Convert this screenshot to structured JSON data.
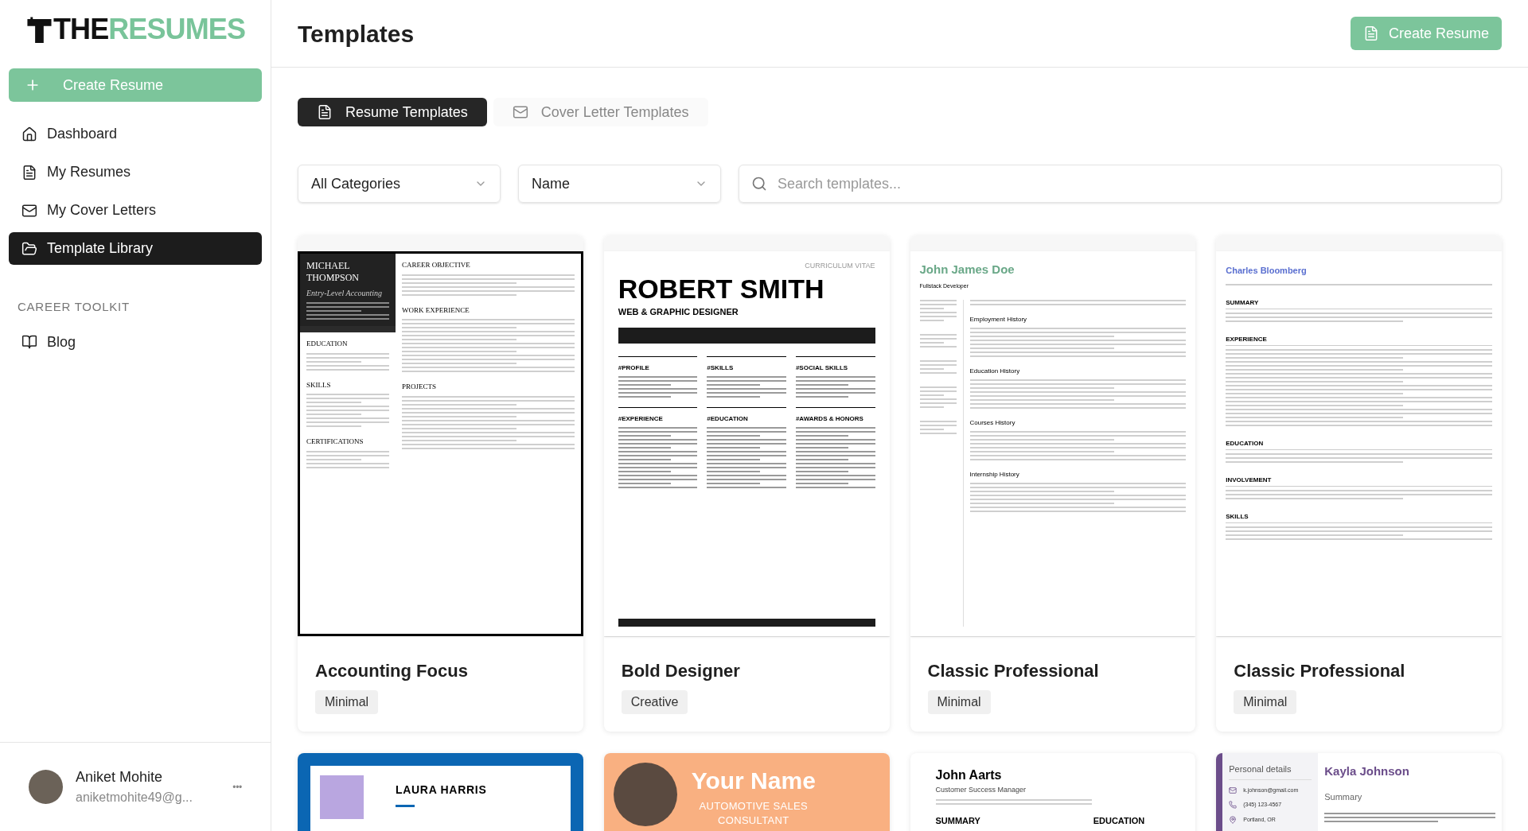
{
  "sidebar": {
    "logo": {
      "prefix": "THE",
      "suffix": "RESUMES"
    },
    "create_button": "Create Resume",
    "items": [
      {
        "label": "Dashboard",
        "selected": false
      },
      {
        "label": "My Resumes",
        "selected": false
      },
      {
        "label": "My Cover Letters",
        "selected": false
      },
      {
        "label": "Template Library",
        "selected": true
      }
    ],
    "section_title": "CAREER TOOLKIT",
    "section_items": [
      {
        "label": "Blog",
        "selected": false
      }
    ],
    "user": {
      "name": "Aniket Mohite",
      "email": "aniketmohite49@g...",
      "menu": "•••"
    }
  },
  "header": {
    "title": "Templates",
    "button": "Create Resume"
  },
  "tabs": [
    {
      "label": "Resume Templates",
      "selected": true
    },
    {
      "label": "Cover Letter Templates",
      "selected": false
    }
  ],
  "filters": {
    "category": "All Categories",
    "sort": "Name",
    "search": {
      "placeholder": "Search templates..."
    }
  },
  "templates": [
    {
      "name": "Accounting Focus",
      "tag": "Minimal",
      "preview": {
        "kind": "dark-sidebar",
        "heading": "MICHAEL THOMPSON",
        "subtitle": "Entry-Level Accounting",
        "side_sections": [
          "EDUCATION",
          "SKILLS",
          "CERTIFICATIONS"
        ],
        "sections": [
          "CAREER OBJECTIVE",
          "WORK EXPERIENCE",
          "PROJECTS"
        ]
      }
    },
    {
      "name": "Bold Designer",
      "tag": "Creative",
      "preview": {
        "kind": "bold-header",
        "label": "CURRICULUM VITAE",
        "heading": "ROBERT SMITH",
        "subtitle": "WEB & GRAPHIC DESIGNER",
        "sections": [
          "#PROFILE",
          "#SKILLS",
          "#SOCIAL SKILLS",
          "#EXPERIENCE",
          "#EDUCATION",
          "#AWARDS & HONORS"
        ]
      }
    },
    {
      "name": "Classic Professional",
      "tag": "Minimal",
      "preview": {
        "kind": "two-column",
        "heading": "John James Doe",
        "subtitle": "Fullstack Developer",
        "sections": [
          "Employment History",
          "Education History",
          "Courses History",
          "Internship History"
        ]
      }
    },
    {
      "name": "Classic Professional",
      "tag": "Minimal",
      "preview": {
        "kind": "single-column",
        "heading": "Charles Bloomberg",
        "sections": [
          "SUMMARY",
          "EXPERIENCE",
          "EDUCATION",
          "INVOLVEMENT",
          "SKILLS"
        ]
      }
    }
  ],
  "more_templates": [
    {
      "kind": "blue-frame",
      "heading": "LAURA HARRIS"
    },
    {
      "kind": "photo-banner",
      "heading": "Your Name",
      "subtitle": "AUTOMOTIVE SALES CONSULTANT"
    },
    {
      "kind": "plain",
      "heading": "John Aarts",
      "subtitle": "Customer Success Manager",
      "sections": [
        "SUMMARY",
        "EDUCATION"
      ]
    },
    {
      "kind": "light-sidebar",
      "side_title": "Personal details",
      "contacts": [
        "k.johnson@gmail.com",
        "(345) 123-4567",
        "Portland, OR"
      ],
      "heading": "Kayla Johnson",
      "sections": [
        "Summary"
      ]
    }
  ]
}
